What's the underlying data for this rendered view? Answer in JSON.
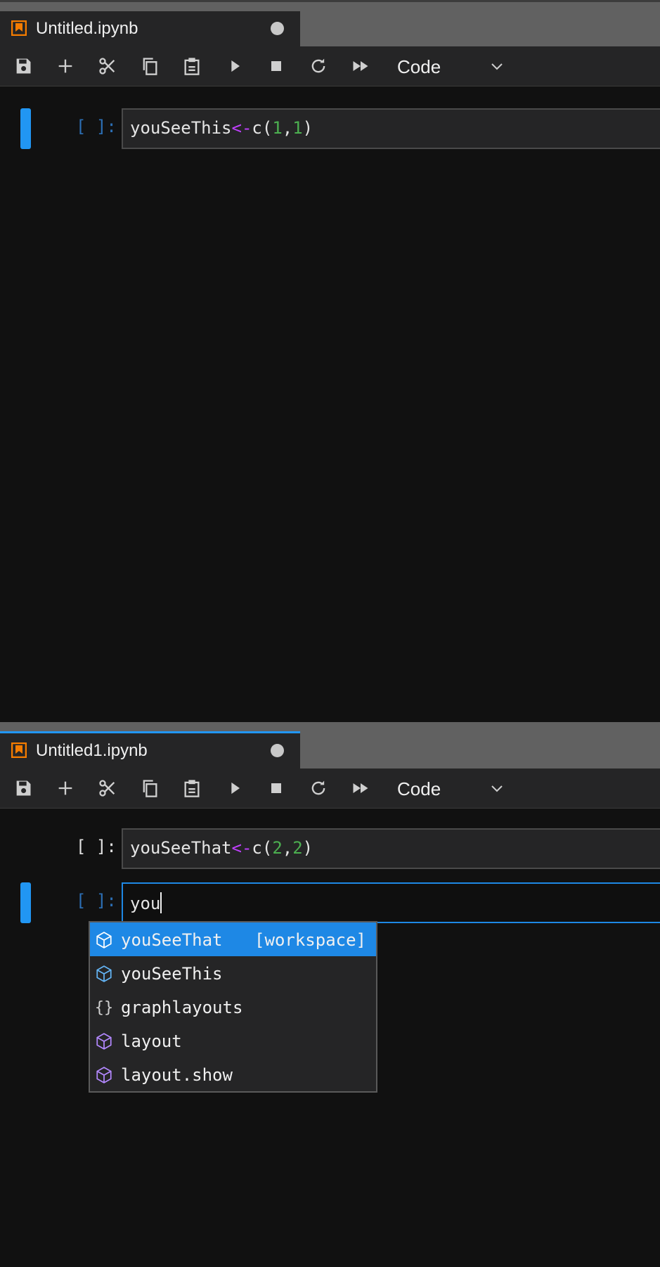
{
  "panels": [
    {
      "tab": {
        "title": "Untitled.ipynb",
        "dirty": true
      },
      "toolbar": {
        "cell_type": "Code"
      },
      "cells": [
        {
          "prompt": "[ ]:",
          "code": {
            "name": "youSeeThis",
            "arrow": "<-",
            "fn": "c(",
            "a": "1",
            "sep": ",",
            "b": "1",
            "close": ")"
          }
        }
      ]
    },
    {
      "tab": {
        "title": "Untitled1.ipynb",
        "dirty": true
      },
      "toolbar": {
        "cell_type": "Code"
      },
      "cells": [
        {
          "prompt": "[ ]:",
          "code": {
            "name": "youSeeThat",
            "arrow": "<-",
            "fn": "c(",
            "a": "2",
            "sep": ",",
            "b": "2",
            "close": ")"
          }
        },
        {
          "prompt": "[ ]:",
          "input_value": "you"
        }
      ]
    }
  ],
  "toolbar_icons": [
    "save-icon",
    "add-cell-icon",
    "cut-icon",
    "copy-icon",
    "paste-icon",
    "run-icon",
    "stop-icon",
    "restart-icon",
    "run-all-icon",
    "chevron-down-icon"
  ],
  "completer": {
    "items": [
      {
        "label": "youSeeThat",
        "type": "[workspace]",
        "icon": "variable-cube-icon",
        "selected": true
      },
      {
        "label": "youSeeThis",
        "type": "",
        "icon": "variable-cube-icon",
        "selected": false
      },
      {
        "label": "graphlayouts",
        "type": "",
        "icon": "namespace-braces-icon",
        "selected": false
      },
      {
        "label": "layout",
        "type": "",
        "icon": "function-cube-icon",
        "selected": false
      },
      {
        "label": "layout.show",
        "type": "",
        "icon": "function-cube-icon",
        "selected": false
      }
    ]
  },
  "colors": {
    "accent": "#2196f3",
    "arrow": "#c040ff",
    "number": "#4caf50",
    "notebook_icon": "#f57c00",
    "function_icon": "#b388ff"
  }
}
